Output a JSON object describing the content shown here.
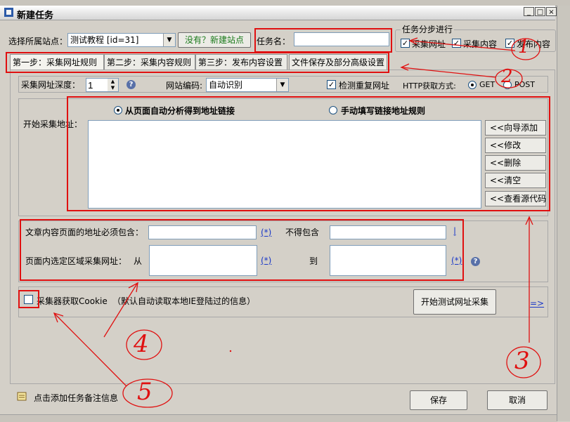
{
  "window": {
    "title": "新建任务",
    "minimize": "_",
    "maximize": "□",
    "close": "×"
  },
  "site": {
    "label": "选择所属站点：",
    "value": "测试教程 [id=31]",
    "new_site_button": "没有？新建站点"
  },
  "task": {
    "name_label": "任务名：",
    "name_value": ""
  },
  "steps_group": {
    "title": "任务分步进行",
    "options": [
      {
        "label": "采集网址",
        "checked": true
      },
      {
        "label": "采集内容",
        "checked": true
      },
      {
        "label": "发布内容",
        "checked": true
      }
    ]
  },
  "tabs": [
    {
      "label": "第一步：采集网址规则",
      "active": true
    },
    {
      "label": "第二步：采集内容规则",
      "active": false
    },
    {
      "label": "第三步：发布内容设置",
      "active": false
    },
    {
      "label": "文件保存及部分高级设置",
      "active": false
    }
  ],
  "options_row": {
    "depth_label": "采集网址深度：",
    "depth_value": "1",
    "encoding_label": "网站编码:",
    "encoding_value": "自动识别",
    "dedupe_label": "检测重复网址",
    "dedupe_checked": true,
    "http_label": "HTTP获取方式:",
    "get_label": "GET",
    "post_label": "POST",
    "method": "GET"
  },
  "start_url": {
    "label": "开始采集地址：",
    "mode_auto": "从页面自动分析得到地址链接",
    "mode_manual": "手动填写链接地址规则",
    "selected_mode": "auto",
    "buttons": [
      "<<向导添加",
      "<<修改",
      "<<删除",
      "<<清空",
      "<<查看源代码"
    ]
  },
  "filter": {
    "must_contain_label": "文章内容页面的地址必须包含：",
    "must_contain_value": "",
    "wildcard": "(*)",
    "must_not_label": "不得包含",
    "must_not_value": "",
    "pipe": "|",
    "region_label": "页面内选定区域采集网址：",
    "from_label": "从",
    "to_label": "到",
    "from_value": "",
    "to_value": ""
  },
  "cookie": {
    "label": "采集器获取Cookie",
    "hint": "（默认自动读取本地IE登陆过的信息）",
    "checked": false
  },
  "test_button": "开始测试网址采集",
  "arrow_link": "=>",
  "footer": {
    "note_label": "点击添加任务备注信息",
    "save": "保存",
    "cancel": "取消"
  },
  "annotations": [
    "1",
    "2",
    "3",
    "4",
    "5"
  ],
  "colors": {
    "annotation_red": "#e01010",
    "panel_bg": "#d4d0c8",
    "link_blue": "#1a38c8"
  }
}
